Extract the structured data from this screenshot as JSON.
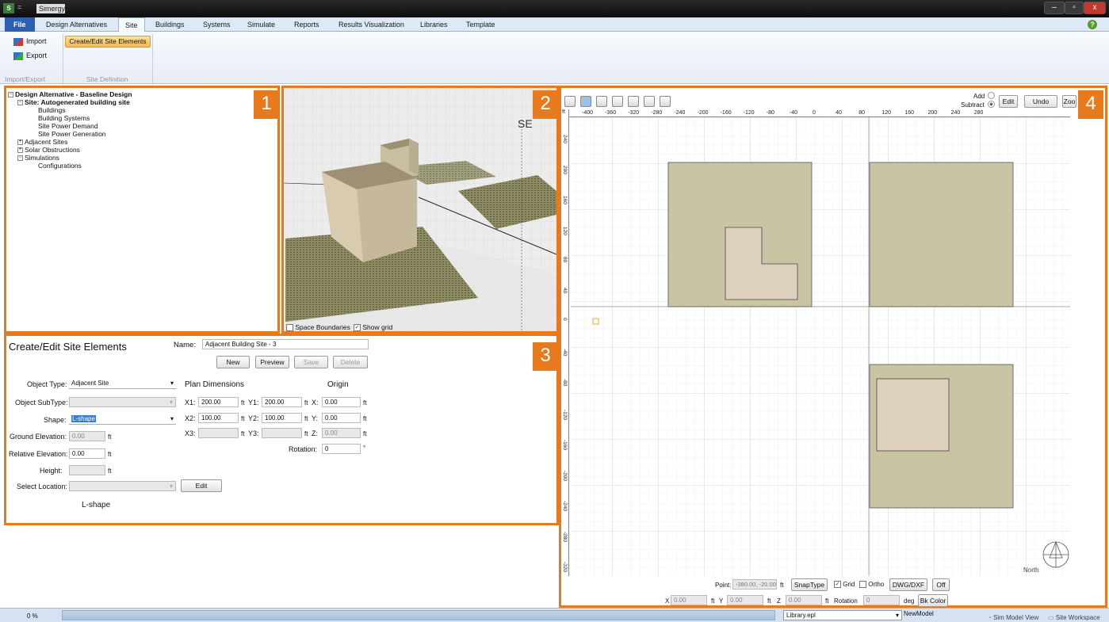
{
  "window": {
    "title": "Simergy",
    "quick_access": "=",
    "min": "–",
    "max": "▫",
    "close": "x"
  },
  "menu": {
    "file": "File",
    "tabs": [
      "Design Alternatives",
      "Site",
      "Buildings",
      "Systems",
      "Simulate",
      "Reports",
      "Results Visualization",
      "Libraries",
      "Template"
    ],
    "active": "Site",
    "help": "?"
  },
  "ribbon": {
    "import": "Import",
    "export": "Export",
    "create_edit": "Create/Edit Site Elements",
    "group1": "Import/Export",
    "group2": "Site Definition"
  },
  "tree": {
    "root": "Design Alternative - Baseline Design",
    "site": "Site: Autogenerated building site",
    "site_children": [
      "Buildings",
      "Building Systems",
      "Site Power Demand",
      "Site Power Generation"
    ],
    "adjacent": "Adjacent Sites",
    "solar": "Solar Obstructions",
    "simulations": "Simulations",
    "configurations": "Configurations"
  },
  "badges": [
    "1",
    "2",
    "3",
    "4"
  ],
  "view3d": {
    "space_boundaries": "Space Boundaries",
    "show_grid": "Show grid",
    "space_boundaries_checked": false,
    "show_grid_checked": true
  },
  "editor": {
    "title": "Create/Edit Site Elements",
    "name_label": "Name:",
    "name_value": "Adjacent Building Site - 3",
    "new": "New",
    "preview": "Preview",
    "save": "Save",
    "delete": "Delete",
    "object_type_label": "Object Type:",
    "object_type": "Adjacent Site",
    "object_subtype_label": "Object SubType:",
    "object_subtype": "",
    "shape_label": "Shape:",
    "shape": "L-shape",
    "ground_elev_label": "Ground Elevation:",
    "ground_elev": "0.00",
    "ground_unit": "ft",
    "rel_elev_label": "Relative Elevation:",
    "rel_elev": "0.00",
    "rel_unit": "ft",
    "height_label": "Height:",
    "height": "",
    "height_unit": "ft",
    "location_label": "Select Location:",
    "location": "",
    "edit": "Edit",
    "shape_caption": "L-shape",
    "plan_title": "Plan Dimensions",
    "origin_title": "Origin",
    "x1_label": "X1:",
    "x1": "200.00",
    "y1_label": "Y1:",
    "y1": "200.00",
    "x2_label": "X2:",
    "x2": "100.00",
    "y2_label": "Y2:",
    "y2": "100.00",
    "x3_label": "X3:",
    "x3": "",
    "y3_label": "Y3:",
    "y3": "",
    "ox_label": "X:",
    "ox": "0.00",
    "oy_label": "Y:",
    "oy": "0.00",
    "oz_label": "Z:",
    "oz": "0.00",
    "rotation_label": "Rotation:",
    "rotation": "0",
    "rotation_unit": "°",
    "unit": "ft"
  },
  "plan": {
    "add": "Add",
    "subtract": "Subtract",
    "edit": "Edit",
    "undo": "Undo",
    "zoom": "Zoo",
    "ruler_unit": "ft",
    "ruler_x": [
      "-400",
      "-360",
      "-320",
      "-280",
      "-240",
      "-200",
      "-160",
      "-120",
      "-80",
      "-40",
      "0",
      "40",
      "80",
      "120",
      "160",
      "200",
      "240",
      "280"
    ],
    "ruler_y": [
      "240",
      "200",
      "160",
      "120",
      "80",
      "40",
      "0",
      "-40",
      "-80",
      "-120",
      "-160",
      "-200",
      "-240",
      "-280",
      "-320"
    ],
    "north": "North",
    "point_label": "Point:",
    "point": "-380.00, -20.00",
    "point_unit": "ft",
    "snap": "SnapType",
    "grid": "Grid",
    "grid_checked": true,
    "ortho": "Ortho",
    "ortho_checked": false,
    "dwg": "DWG/DXF",
    "off": "Off",
    "x_label": "X",
    "x": "0.00",
    "y_label": "Y",
    "y": "0.00",
    "z_label": "Z",
    "z": "0.00",
    "rot_label": "Rotation",
    "rot": "0",
    "deg": "deg",
    "ft": "ft",
    "bk": "Bk Color"
  },
  "status": {
    "progress": "0 %",
    "library": "Library.epl",
    "model": "NewModel",
    "sim_view": "Sim Model View",
    "site_ws": "Site Workspace"
  },
  "colors": {
    "accent": "#e87a1e",
    "site_fill": "#c9c4a3",
    "building_fill": "#ddd0bc"
  }
}
